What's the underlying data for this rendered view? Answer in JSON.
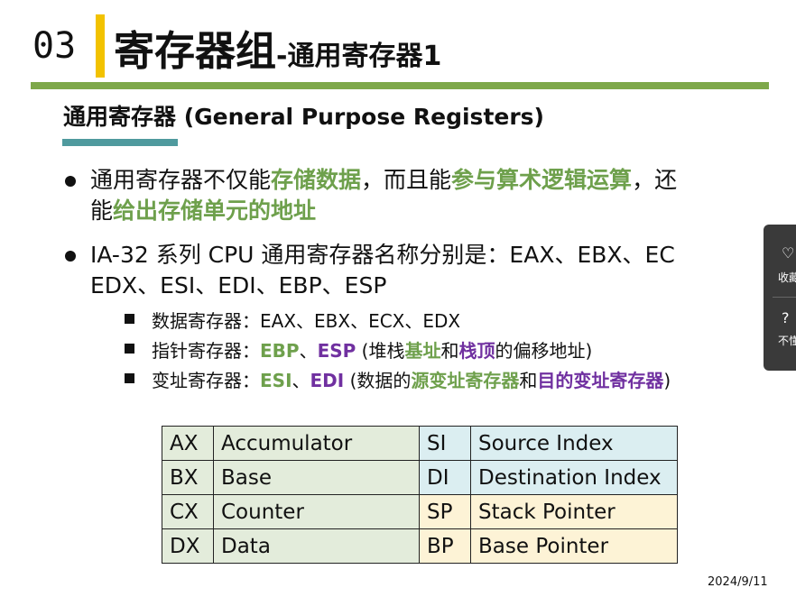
{
  "header": {
    "number": "03",
    "title_main": "寄存器组",
    "title_sep": "-",
    "title_sub": "通用寄存器1"
  },
  "subtitle": "通用寄存器 (General Purpose Registers)",
  "bullet1": {
    "line1": [
      {
        "text": "通用寄存器不仅能",
        "style": "normal"
      },
      {
        "text": "存储数据",
        "style": "green"
      },
      {
        "text": "，而且能",
        "style": "normal"
      },
      {
        "text": "参与算术逻辑运算",
        "style": "green"
      },
      {
        "text": "，还",
        "style": "normal"
      }
    ],
    "line2": [
      {
        "text": "能",
        "style": "normal"
      },
      {
        "text": "给出存储单元的地址",
        "style": "green"
      }
    ]
  },
  "bullet2": {
    "line1": "IA-32 系列 CPU 通用寄存器名称分别是：EAX、EBX、EC",
    "line2": "EDX、ESI、EDI、EBP、ESP"
  },
  "sub_items": [
    [
      {
        "text": "数据寄存器：EAX、EBX、ECX、EDX",
        "style": "normal"
      }
    ],
    [
      {
        "text": "指针寄存器：",
        "style": "normal"
      },
      {
        "text": "EBP",
        "style": "green"
      },
      {
        "text": "、",
        "style": "normal"
      },
      {
        "text": "ESP",
        "style": "purple"
      },
      {
        "text": " (堆栈",
        "style": "normal"
      },
      {
        "text": "基址",
        "style": "green"
      },
      {
        "text": "和",
        "style": "normal"
      },
      {
        "text": "栈顶",
        "style": "purple"
      },
      {
        "text": "的偏移地址)",
        "style": "normal"
      }
    ],
    [
      {
        "text": "变址寄存器：",
        "style": "normal"
      },
      {
        "text": "ESI",
        "style": "green"
      },
      {
        "text": "、",
        "style": "normal"
      },
      {
        "text": "EDI",
        "style": "purple"
      },
      {
        "text": " (数据的",
        "style": "normal"
      },
      {
        "text": "源变址寄存器",
        "style": "green"
      },
      {
        "text": "和",
        "style": "normal"
      },
      {
        "text": "目的变址寄存器",
        "style": "purple"
      },
      {
        "text": ")",
        "style": "normal"
      }
    ]
  ],
  "table": {
    "rows": [
      [
        "AX",
        "Accumulator",
        "SI",
        "Source Index"
      ],
      [
        "BX",
        "Base",
        "DI",
        "Destination Index"
      ],
      [
        "CX",
        "Counter",
        "SP",
        "Stack Pointer"
      ],
      [
        "DX",
        "Data",
        "BP",
        "Base Pointer"
      ]
    ]
  },
  "side_panel": {
    "items": [
      {
        "icon": "heart-icon",
        "glyph": "♡",
        "label": "收藏"
      },
      {
        "icon": "question-icon",
        "glyph": "?",
        "label": "不懂"
      }
    ]
  },
  "footer": {
    "date": "2024/9/11"
  },
  "colors": {
    "accent_yellow": "#f2c200",
    "green": "#6ea04c",
    "purple": "#7030a0",
    "rule_green": "#7ea84a",
    "teal": "#4f9a9e"
  }
}
